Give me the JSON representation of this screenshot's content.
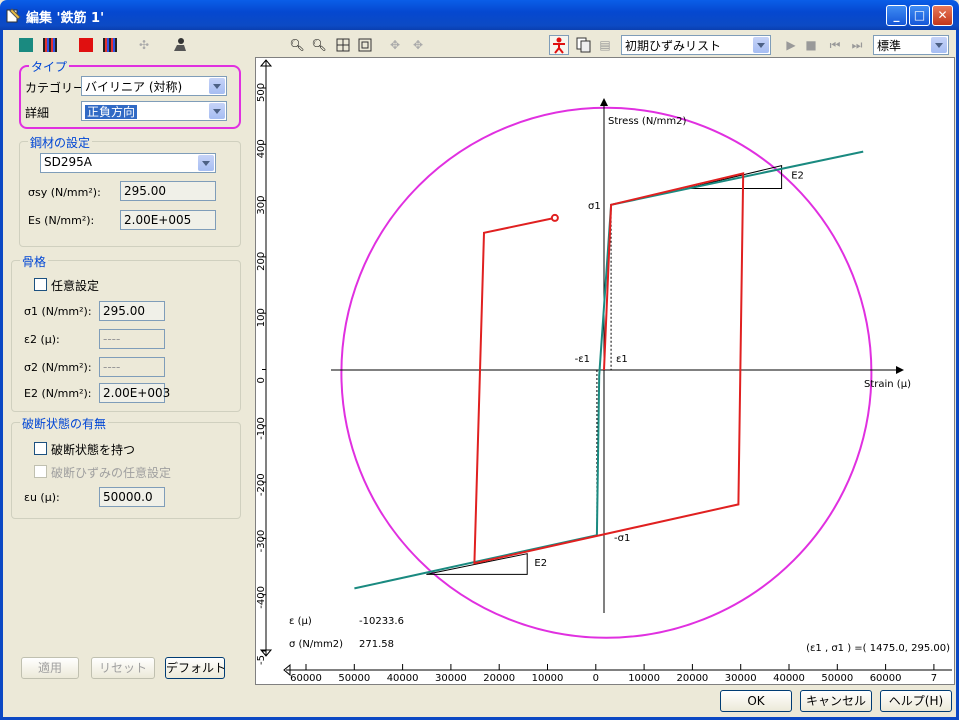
{
  "window": {
    "title": "編集 '鉄筋 1'"
  },
  "type_group": {
    "title": "タイプ",
    "category_label": "カテゴリー",
    "category_value": "バイリニア (対称)",
    "detail_label": "詳細",
    "detail_value": "正負方向"
  },
  "steel_group": {
    "title": "鋼材の設定",
    "material_value": "SD295A",
    "sigma_sy_label": "σsy (N/mm²):",
    "sigma_sy_value": "295.00",
    "es_label": "Es (N/mm²):",
    "es_value": "2.00E+005"
  },
  "skeleton_group": {
    "title": "骨格",
    "custom_label": "任意設定",
    "sigma1_label": "σ1 (N/mm²):",
    "sigma1_value": "295.00",
    "eps2_label": "ε2 (μ):",
    "eps2_value": "----",
    "sigma2_label": "σ2 (N/mm²):",
    "sigma2_value": "----",
    "e2_label": "E2 (N/mm²):",
    "e2_value": "2.00E+003"
  },
  "fracture_group": {
    "title": "破断状態の有無",
    "has_fracture_label": "破断状態を持つ",
    "custom_strain_label": "破断ひずみの任意設定",
    "eps_u_label": "εu (μ):",
    "eps_u_value": "50000.0"
  },
  "panel_buttons": {
    "apply": "適用",
    "reset": "リセット",
    "default": "デフォルト"
  },
  "plot_toolbar": {
    "list_value": "初期ひずみリスト",
    "mode_value": "標準"
  },
  "plot": {
    "stress_axis_label": "Stress (N/mm2)",
    "strain_axis_label": "Strain (μ)",
    "sigma1_pos": "σ1",
    "sigma1_neg": "-σ1",
    "eps1_pos": "ε1",
    "eps1_neg": "-ε1",
    "e2_pos": "E2",
    "e2_neg": "E2",
    "readout_eps_label": "ε (μ)",
    "readout_eps_value": "-10233.6",
    "readout_sigma_label": "σ (N/mm2)",
    "readout_sigma_value": "271.58",
    "point_readout": "(ε1 , σ1 ) =( 1475.0, 295.00)"
  },
  "dialog_buttons": {
    "ok": "OK",
    "cancel": "キャンセル",
    "help": "ヘルプ(H)"
  },
  "chart_data": {
    "type": "line",
    "xlabel": "Strain (μ)",
    "ylabel": "Stress (N/mm2)",
    "xlim": [
      -60000,
      70000
    ],
    "ylim": [
      -500,
      500
    ],
    "x_ticks": [
      "60000",
      "50000",
      "40000",
      "30000",
      "20000",
      "10000",
      "0",
      "10000",
      "20000",
      "30000",
      "40000",
      "50000",
      "60000",
      "7"
    ],
    "y_ticks": [
      "500",
      "400",
      "300",
      "200",
      "100",
      "0",
      "-100",
      "-200",
      "-300",
      "-400",
      "-5"
    ],
    "colors": {
      "hysteresis": "#e02020",
      "skeleton": "#1a8a80",
      "circle": "#e030e0"
    },
    "series": [
      {
        "name": "",
        "points": [
          [
            0,
            0
          ],
          [
            1475,
            295
          ],
          [
            29000,
            351
          ],
          [
            28000,
            -240
          ],
          [
            -27000,
            -345
          ],
          [
            -25000,
            245
          ],
          [
            -10233.6,
            271.58
          ]
        ]
      },
      {
        "name": "",
        "points": [
          [
            -52000,
            -390
          ],
          [
            -1475,
            -295
          ],
          [
            -1475,
            -295
          ],
          [
            -1000,
            -10
          ],
          [
            1475,
            295
          ],
          [
            54000,
            390
          ]
        ]
      }
    ]
  }
}
